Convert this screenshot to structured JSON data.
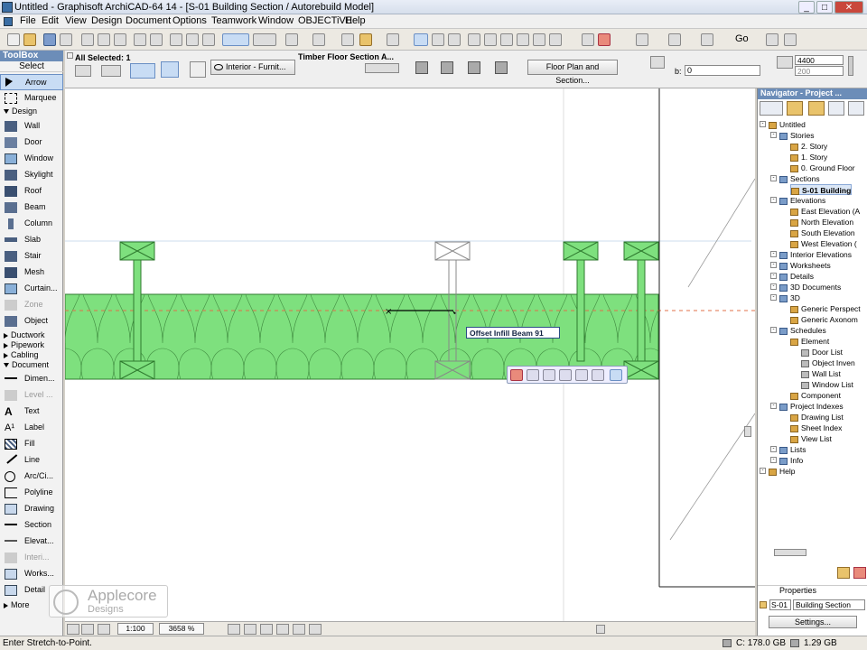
{
  "window": {
    "title": "Untitled - Graphisoft ArchiCAD-64 14 - [S-01 Building Section / Autorebuild Model]",
    "controls": [
      "_",
      "□",
      "✕"
    ]
  },
  "menubar": {
    "items": [
      "File",
      "Edit",
      "View",
      "Design",
      "Document",
      "Options",
      "Teamwork",
      "Window",
      "OBJECTiVE",
      "Help"
    ]
  },
  "toolbox": {
    "header": "ToolBox",
    "select_label": "Select",
    "arrow": "Arrow",
    "marquee": "Marquee",
    "design_group": "Design",
    "design_tools": [
      "Wall",
      "Door",
      "Window",
      "Skylight",
      "Roof",
      "Beam",
      "Column",
      "Slab",
      "Stair",
      "Mesh",
      "Curtain...",
      "Zone",
      "Object"
    ],
    "groups": [
      "Ductwork",
      "Pipework",
      "Cabling",
      "Document"
    ],
    "document_tools": [
      "Dimen...",
      "Level ...",
      "Text",
      "Label",
      "Fill",
      "Line",
      "Arc/Ci...",
      "Polyline",
      "Drawing",
      "Section",
      "Elevat...",
      "Interi...",
      "Works...",
      "Detail"
    ],
    "more": "More"
  },
  "infobox": {
    "all_selected": "All Selected: 1",
    "edit_label": "Edit",
    "layer": "Interior - Furnit...",
    "object_name": "Timber Floor Section A...",
    "floor_plan_btn": "Floor Plan and Section...",
    "b_label": "b:",
    "b_value": "0",
    "dim_top": "4400",
    "dim_bottom": "200"
  },
  "canvas": {
    "tooltip": "Offset Infill Beam  91",
    "fill_color": "#7ee07e"
  },
  "navigator": {
    "header": "Navigator - Project ...",
    "tree": [
      {
        "label": "Untitled",
        "level": 0
      },
      {
        "label": "Stories",
        "level": 1
      },
      {
        "label": "2. Story",
        "level": 2
      },
      {
        "label": "1. Story",
        "level": 2
      },
      {
        "label": "0. Ground Floor",
        "level": 2
      },
      {
        "label": "Sections",
        "level": 1
      },
      {
        "label": "S-01 Building",
        "level": 2,
        "selected": true
      },
      {
        "label": "Elevations",
        "level": 1
      },
      {
        "label": "East Elevation (A",
        "level": 2
      },
      {
        "label": "North Elevation",
        "level": 2
      },
      {
        "label": "South Elevation",
        "level": 2
      },
      {
        "label": "West Elevation (",
        "level": 2
      },
      {
        "label": "Interior Elevations",
        "level": 1
      },
      {
        "label": "Worksheets",
        "level": 1
      },
      {
        "label": "Details",
        "level": 1
      },
      {
        "label": "3D Documents",
        "level": 1
      },
      {
        "label": "3D",
        "level": 1
      },
      {
        "label": "Generic Perspect",
        "level": 2
      },
      {
        "label": "Generic Axonom",
        "level": 2
      },
      {
        "label": "Schedules",
        "level": 1
      },
      {
        "label": "Element",
        "level": 2
      },
      {
        "label": "Door List",
        "level": 3
      },
      {
        "label": "Object Inven",
        "level": 3
      },
      {
        "label": "Wall List",
        "level": 3
      },
      {
        "label": "Window List",
        "level": 3
      },
      {
        "label": "Component",
        "level": 2
      },
      {
        "label": "Project Indexes",
        "level": 1
      },
      {
        "label": "Drawing List",
        "level": 2
      },
      {
        "label": "Sheet Index",
        "level": 2
      },
      {
        "label": "View List",
        "level": 2
      },
      {
        "label": "Lists",
        "level": 1
      },
      {
        "label": "Info",
        "level": 1
      },
      {
        "label": "Help",
        "level": 0
      }
    ],
    "properties_label": "Properties",
    "prop_id": "S-01",
    "prop_name": "Building Section",
    "settings_btn": "Settings..."
  },
  "bottombar": {
    "scale": "1:100",
    "zoom": "3658 %"
  },
  "toolbar": {
    "go_label": "Go"
  },
  "status": {
    "message": "Enter Stretch-to-Point.",
    "disk": "C: 178.0 GB",
    "ram": "1.29 GB"
  },
  "logo": {
    "brand": "Applecore",
    "sub": "Designs"
  }
}
